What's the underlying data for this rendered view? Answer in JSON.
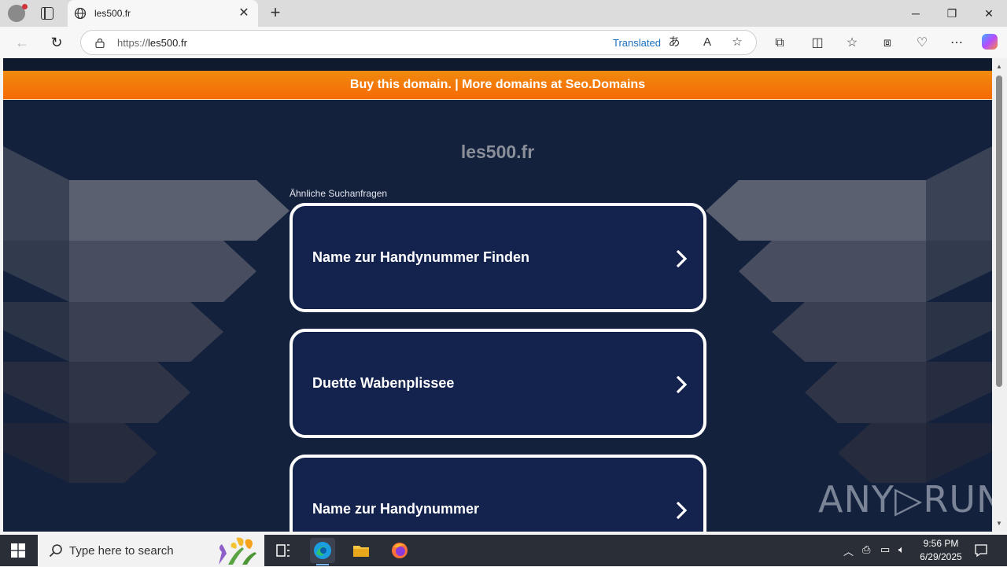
{
  "browser": {
    "tab_title": "les500.fr",
    "url_protocol": "https://",
    "url_host": "les500.fr",
    "translated_label": "Translated"
  },
  "page": {
    "banner_text": "Buy this domain. | More domains at Seo.Domains",
    "site_title": "les500.fr",
    "related_label": "Ähnliche Suchanfragen",
    "cards": [
      {
        "label": "Name zur Handynummer Finden"
      },
      {
        "label": "Duette Wabenplissee"
      },
      {
        "label": "Name zur Handynummer"
      }
    ],
    "watermark": "ANY▷RUN"
  },
  "taskbar": {
    "search_placeholder": "Type here to search",
    "time": "9:56 PM",
    "date": "6/29/2025"
  },
  "colors": {
    "page_bg": "#13213d",
    "banner": "#f57c08",
    "card_bg": "#13234d",
    "accent_link": "#1a6fbf"
  }
}
